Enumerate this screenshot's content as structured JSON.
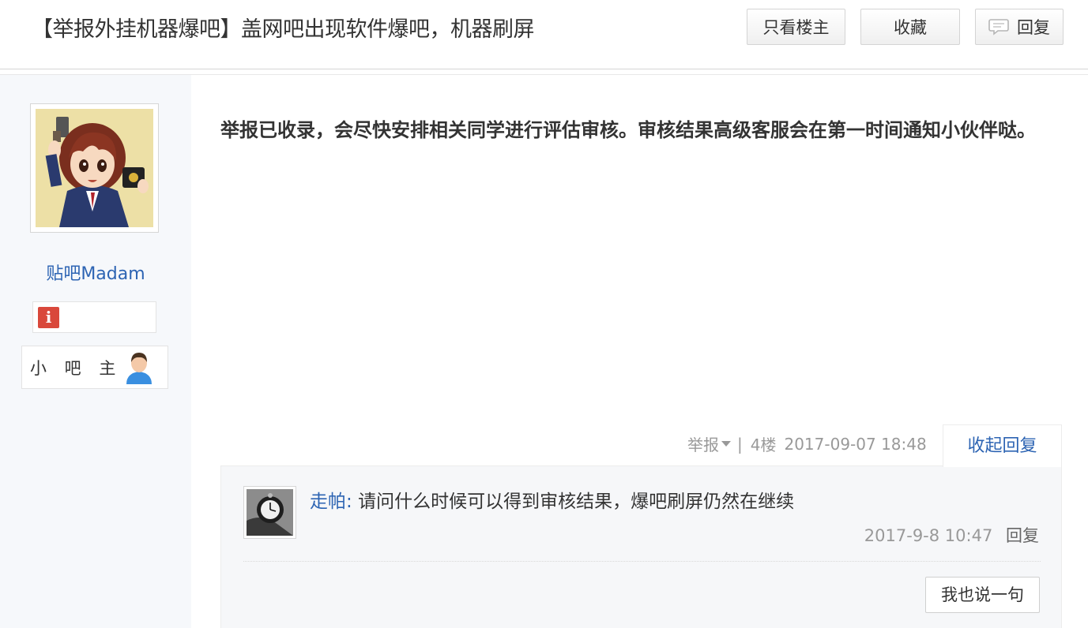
{
  "header": {
    "title": "【举报外挂机器爆吧】盖网吧出现软件爆吧，机器刷屏",
    "buttons": {
      "louzhu": "只看楼主",
      "collect": "收藏",
      "reply": "回复"
    }
  },
  "author": {
    "name": "贴吧Madam",
    "role": "小 吧 主",
    "avatar_icon": "anime-girl-avatar",
    "badge_icon": "info-icon"
  },
  "post": {
    "content": "举报已收录，会尽快安排相关同学进行评估审核。审核结果高级客服会在第一时间通知小伙伴哒。",
    "report_label": "举报",
    "separator": "|",
    "floor": "4楼",
    "time": "2017-09-07 18:48",
    "collapse_label": "收起回复"
  },
  "replies": [
    {
      "user": "走帕",
      "colon": ":",
      "text": "请问什么时候可以得到审核结果，爆吧刷屏仍然在继续",
      "time": "2017-9-8 10:47",
      "reply_label": "回复"
    }
  ],
  "say_button": "我也说一句",
  "colors": {
    "link": "#2d64b3",
    "meta": "#999999",
    "sidebar_bg": "#f6f8fb",
    "reply_bg": "#f6f7f9",
    "badge_red": "#d9483b"
  }
}
